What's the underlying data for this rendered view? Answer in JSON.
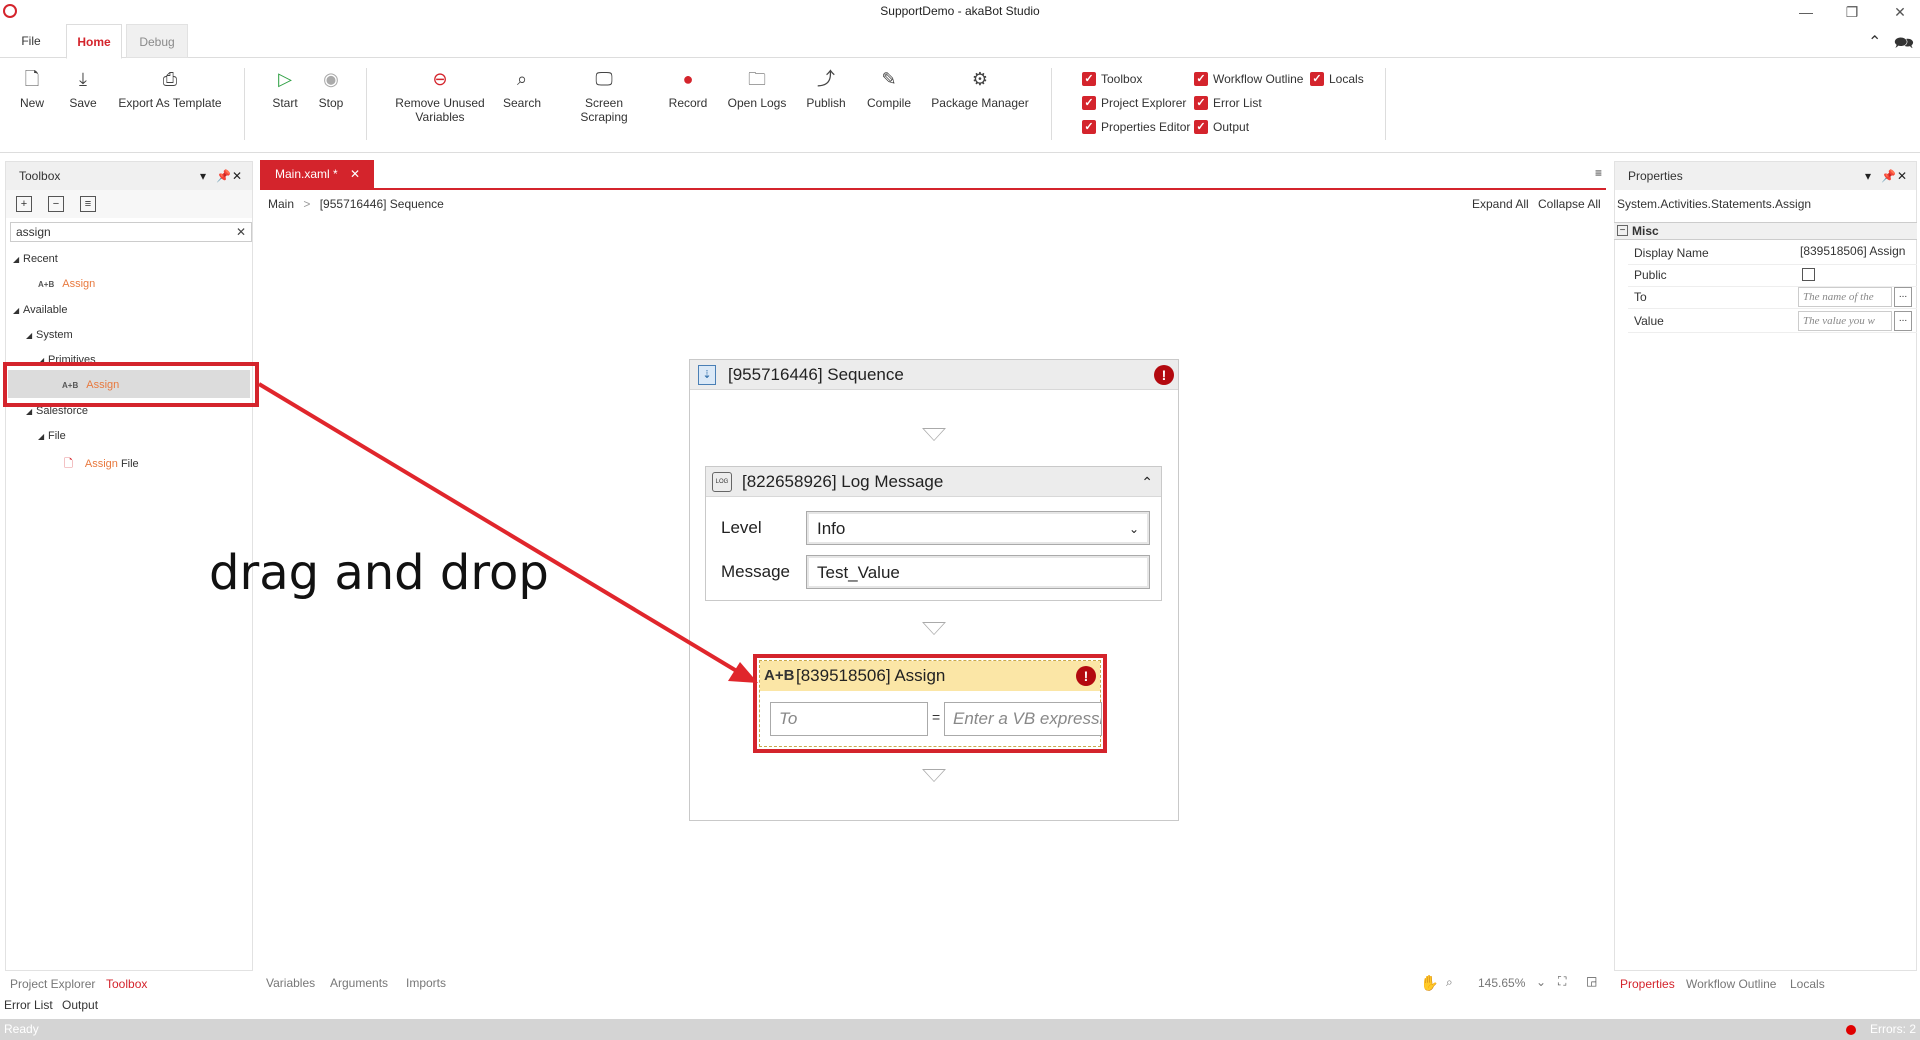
{
  "window": {
    "title": "SupportDemo - akaBot Studio"
  },
  "ribbon_tabs": {
    "file": "File",
    "home": "Home",
    "debug": "Debug"
  },
  "ribbon": {
    "new": "New",
    "save": "Save",
    "export_template": "Export As Template",
    "start": "Start",
    "stop": "Stop",
    "remove_unused_1": "Remove Unused",
    "remove_unused_2": "Variables",
    "search": "Search",
    "screen_scraping": "Screen Scraping",
    "record": "Record",
    "open_logs": "Open Logs",
    "publish": "Publish",
    "compile": "Compile",
    "package_manager": "Package Manager",
    "checkboxes": {
      "toolbox": "Toolbox",
      "project_explorer": "Project Explorer",
      "properties_editor": "Properties Editor",
      "workflow_outline": "Workflow Outline",
      "error_list": "Error List",
      "output": "Output",
      "locals": "Locals"
    }
  },
  "toolbox": {
    "title": "Toolbox",
    "search_value": "assign",
    "tree": {
      "recent": "Recent",
      "recent_assign": "Assign",
      "available": "Available",
      "system": "System",
      "primitives": "Primitives",
      "primitives_assign": "Assign",
      "salesforce": "Salesforce",
      "file": "File",
      "assign_file_a": "Assign",
      "assign_file_b": " File",
      "ab_label": "A+B"
    }
  },
  "document": {
    "tab": "Main.xaml *",
    "breadcrumb_root": "Main",
    "breadcrumb_sep": ">",
    "breadcrumb_current": "[955716446] Sequence",
    "expand_all": "Expand All",
    "collapse_all": "Collapse All"
  },
  "canvas": {
    "sequence_title": "[955716446] Sequence",
    "log_title": "[822658926] Log Message",
    "level_label": "Level",
    "level_value": "Info",
    "message_label": "Message",
    "message_value": "Test_Value",
    "assign_icon": "A+B",
    "assign_title": "[839518506] Assign",
    "to_placeholder": "To",
    "equals": "=",
    "value_placeholder": "Enter a VB expressi"
  },
  "annotation": {
    "text": "drag and drop"
  },
  "properties": {
    "title": "Properties",
    "type": "System.Activities.Statements.Assign",
    "category": "Misc",
    "rows": {
      "display_name_key": "Display Name",
      "display_name_value": "[839518506] Assign",
      "public_key": "Public",
      "to_key": "To",
      "to_placeholder": "The name of the",
      "value_key": "Value",
      "value_placeholder": "The value you w"
    }
  },
  "bottom": {
    "project_explorer": "Project Explorer",
    "toolbox": "Toolbox",
    "error_list": "Error List",
    "output": "Output",
    "variables": "Variables",
    "arguments": "Arguments",
    "imports": "Imports",
    "zoom": "145.65%",
    "properties": "Properties",
    "workflow_outline": "Workflow Outline",
    "locals": "Locals"
  },
  "status": {
    "ready": "Ready",
    "errors": "Errors: 2"
  },
  "colors": {
    "accent": "#d4242c",
    "assign_header": "#fbe6a6",
    "error": "#b3090f"
  }
}
